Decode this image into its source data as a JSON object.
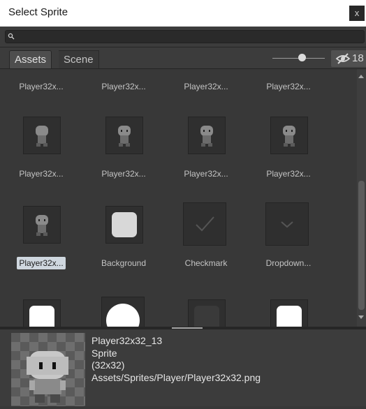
{
  "window": {
    "title": "Select Sprite",
    "close_label": "x"
  },
  "search": {
    "placeholder": ""
  },
  "tabs": [
    {
      "label": "Assets"
    },
    {
      "label": "Scene"
    }
  ],
  "hidden_count": "18",
  "zoom_slider": {
    "value": 0.5
  },
  "grid": {
    "top_labels": [
      "Player32x...",
      "Player32x...",
      "Player32x...",
      "Player32x..."
    ],
    "row1_labels": [
      "Player32x...",
      "Player32x...",
      "Player32x...",
      "Player32x..."
    ],
    "row2_labels": [
      "Player32x...",
      "Background",
      "Checkmark",
      "Dropdown..."
    ],
    "selected_item": "Player32x..."
  },
  "preview": {
    "name": "Player32x32_13",
    "type": "Sprite",
    "size": "(32x32)",
    "path": "Assets/Sprites/Player/Player32x32.png"
  },
  "colors": {
    "background": "#383838",
    "selection": "#cfd7df",
    "titlebar": "#ffffff"
  }
}
